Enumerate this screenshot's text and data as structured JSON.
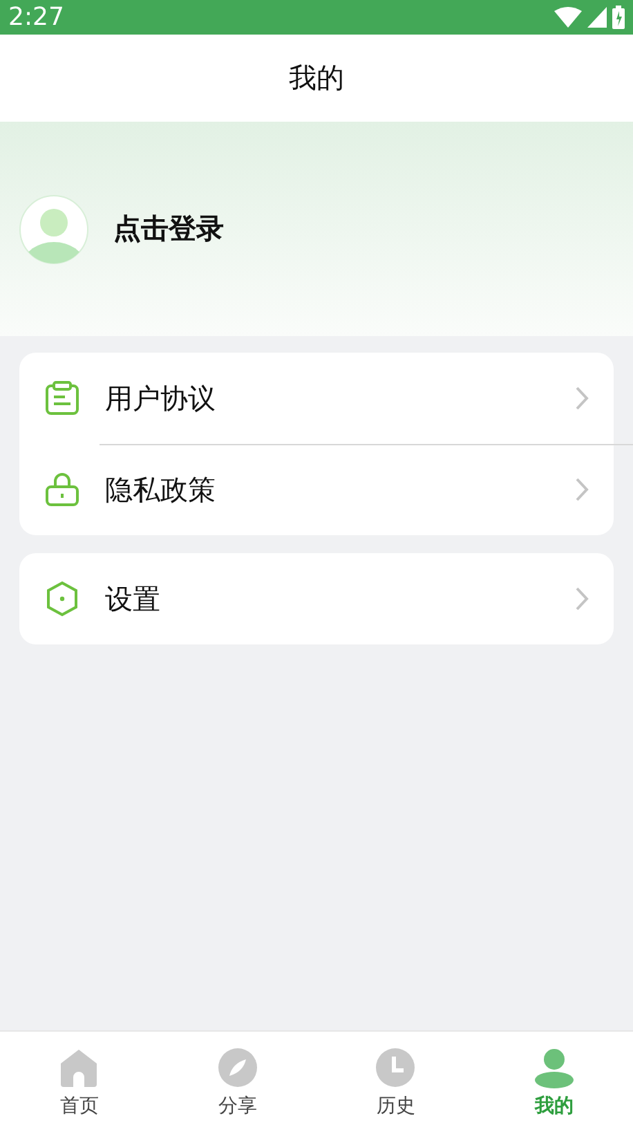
{
  "status_bar": {
    "time": "2:27"
  },
  "header": {
    "title": "我的"
  },
  "profile": {
    "login_label": "点击登录"
  },
  "menu_groups": [
    {
      "items": [
        {
          "kind": "document",
          "label": "用户协议"
        },
        {
          "kind": "lock",
          "label": "隐私政策"
        }
      ]
    },
    {
      "items": [
        {
          "kind": "hexagon",
          "label": "设置"
        }
      ]
    }
  ],
  "tab_bar": [
    {
      "kind": "home",
      "label": "首页",
      "selected": false
    },
    {
      "kind": "compass",
      "label": "分享",
      "selected": false
    },
    {
      "kind": "clock",
      "label": "历史",
      "selected": false
    },
    {
      "kind": "person",
      "label": "我的",
      "selected": true
    }
  ]
}
